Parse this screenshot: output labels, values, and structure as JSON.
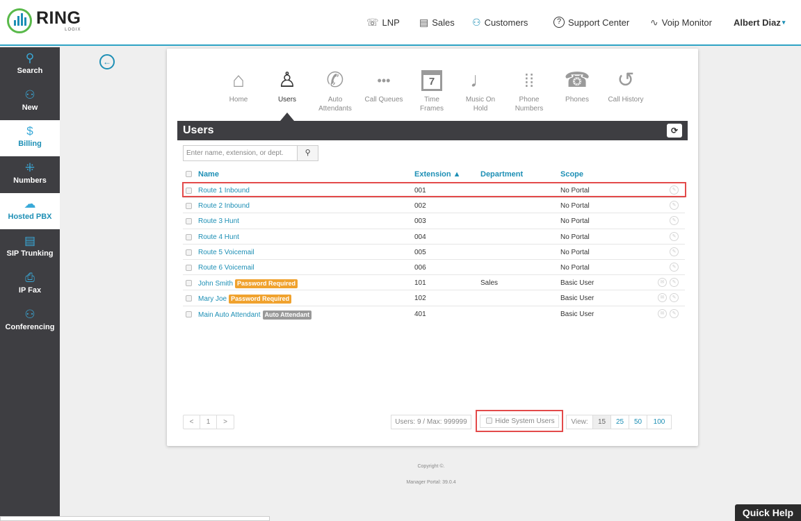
{
  "brand": {
    "name": "RING",
    "sub": "LOGIX"
  },
  "topnav": [
    {
      "id": "lnp",
      "icon": "lnp-icon",
      "glyph": "☏",
      "label": "LNP"
    },
    {
      "id": "sales",
      "icon": "sales-icon",
      "glyph": "▤",
      "label": "Sales"
    },
    {
      "id": "customers",
      "icon": "customers-icon",
      "glyph": "⚇",
      "label": "Customers"
    },
    {
      "id": "support",
      "icon": "support-icon",
      "glyph": "?",
      "label": "Support Center"
    },
    {
      "id": "voip",
      "icon": "pulse-icon",
      "glyph": "∿",
      "label": "Voip Monitor"
    }
  ],
  "user": {
    "name": "Albert Diaz"
  },
  "sidebar": [
    {
      "id": "search",
      "glyph": "⚲",
      "label": "Search"
    },
    {
      "id": "new",
      "glyph": "⚇",
      "label": "New"
    },
    {
      "id": "billing",
      "glyph": "$",
      "label": "Billing"
    },
    {
      "id": "numbers",
      "glyph": "⁜",
      "label": "Numbers"
    },
    {
      "id": "hosted-pbx",
      "glyph": "☁",
      "label": "Hosted PBX"
    },
    {
      "id": "sip-trunking",
      "glyph": "▤",
      "label": "SIP Trunking"
    },
    {
      "id": "ip-fax",
      "glyph": "⎙",
      "label": "IP Fax"
    },
    {
      "id": "conferencing",
      "glyph": "⚇",
      "label": "Conferencing"
    }
  ],
  "apps": [
    {
      "id": "home",
      "glyph": "⌂",
      "label1": "Home",
      "label2": ""
    },
    {
      "id": "users",
      "glyph": "♙",
      "label1": "Users",
      "label2": ""
    },
    {
      "id": "auto-attendants",
      "glyph": "✆",
      "label1": "Auto",
      "label2": "Attendants"
    },
    {
      "id": "call-queues",
      "glyph": "•••",
      "label1": "Call Queues",
      "label2": ""
    },
    {
      "id": "time-frames",
      "glyph": "7",
      "label1": "Time",
      "label2": "Frames"
    },
    {
      "id": "music-on-hold",
      "glyph": "♩",
      "label1": "Music On",
      "label2": "Hold"
    },
    {
      "id": "phone-numbers",
      "glyph": "⁞⁞",
      "label1": "Phone",
      "label2": "Numbers"
    },
    {
      "id": "phones",
      "glyph": "☎",
      "label1": "Phones",
      "label2": ""
    },
    {
      "id": "call-history",
      "glyph": "↺",
      "label1": "Call History",
      "label2": ""
    }
  ],
  "panel": {
    "title": "Users"
  },
  "search": {
    "placeholder": "Enter name, extension, or dept.",
    "value": ""
  },
  "table": {
    "headers": {
      "name": "Name",
      "extension": "Extension ▲",
      "department": "Department",
      "scope": "Scope"
    },
    "rows": [
      {
        "name": "Route 1 Inbound",
        "badge": "",
        "badge_color": "",
        "ext": "001",
        "dept": "",
        "scope": "No Portal",
        "msg": false
      },
      {
        "name": "Route 2 Inbound",
        "badge": "",
        "badge_color": "",
        "ext": "002",
        "dept": "",
        "scope": "No Portal",
        "msg": false
      },
      {
        "name": "Route 3 Hunt",
        "badge": "",
        "badge_color": "",
        "ext": "003",
        "dept": "",
        "scope": "No Portal",
        "msg": false
      },
      {
        "name": "Route 4 Hunt",
        "badge": "",
        "badge_color": "",
        "ext": "004",
        "dept": "",
        "scope": "No Portal",
        "msg": false
      },
      {
        "name": "Route 5 Voicemail",
        "badge": "",
        "badge_color": "",
        "ext": "005",
        "dept": "",
        "scope": "No Portal",
        "msg": false
      },
      {
        "name": "Route 6 Voicemail",
        "badge": "",
        "badge_color": "",
        "ext": "006",
        "dept": "",
        "scope": "No Portal",
        "msg": false
      },
      {
        "name": "John Smith",
        "badge": "Password Required",
        "badge_color": "orange",
        "ext": "101",
        "dept": "Sales",
        "scope": "Basic User",
        "msg": true
      },
      {
        "name": "Mary Joe",
        "badge": "Password Required",
        "badge_color": "orange",
        "ext": "102",
        "dept": "",
        "scope": "Basic User",
        "msg": true
      },
      {
        "name": "Main Auto Attendant",
        "badge": "Auto Attendant",
        "badge_color": "gray",
        "ext": "401",
        "dept": "",
        "scope": "Basic User",
        "msg": true
      }
    ]
  },
  "pager": {
    "prev": "<",
    "page": "1",
    "next": ">"
  },
  "counts": "Users: 9 / Max: 999999",
  "hide_system": "Hide System Users",
  "view": {
    "label": "View:",
    "options": [
      "15",
      "25",
      "50",
      "100"
    ]
  },
  "footer": {
    "copyright": "Copyright ©.",
    "version": "Manager Portal: 39.0.4"
  },
  "quick_help": "Quick Help"
}
